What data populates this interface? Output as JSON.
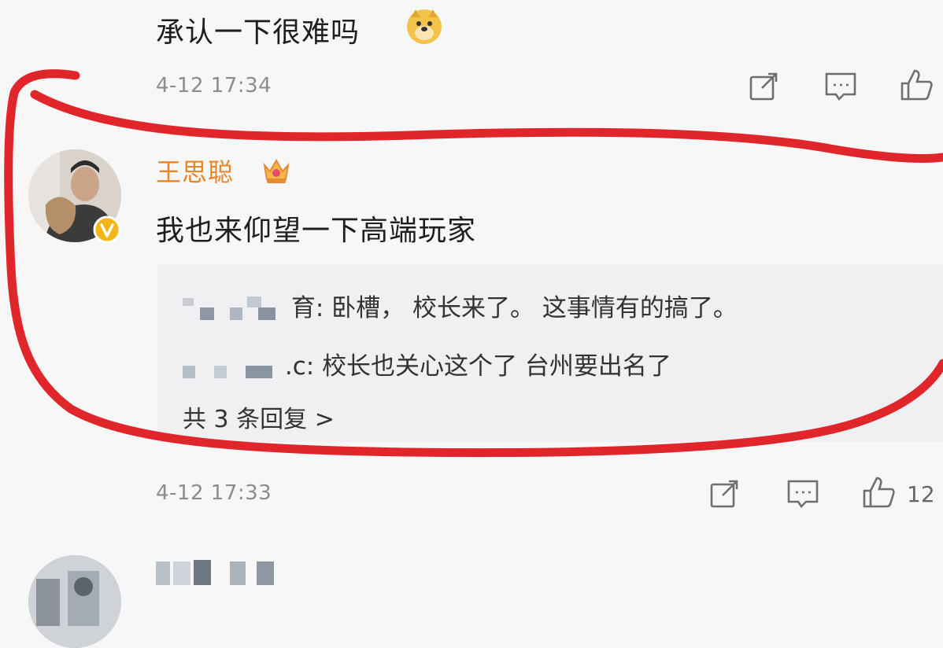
{
  "prev_comment": {
    "text": "承认一下很难吗",
    "emoji": "doge-emoji",
    "time": "4-12 17:34"
  },
  "main_comment": {
    "username": "王思聪",
    "text": "我也来仰望一下高端玩家",
    "time": "4-12 17:33",
    "like_count": "12",
    "replies": [
      {
        "author_suffix": "育:",
        "text": "卧槽， 校长来了。 这事情有的搞了。"
      },
      {
        "author_suffix": ".c:",
        "text": "校长也关心这个了 台州要出名了"
      }
    ],
    "more_replies": "共 3 条回复 >"
  },
  "icons": {
    "share": "share-icon",
    "comment": "comment-icon",
    "like": "thumbs-up-icon"
  },
  "colors": {
    "annotation": "#e0262a",
    "username": "#e8872a",
    "verified": "#f4b516"
  }
}
